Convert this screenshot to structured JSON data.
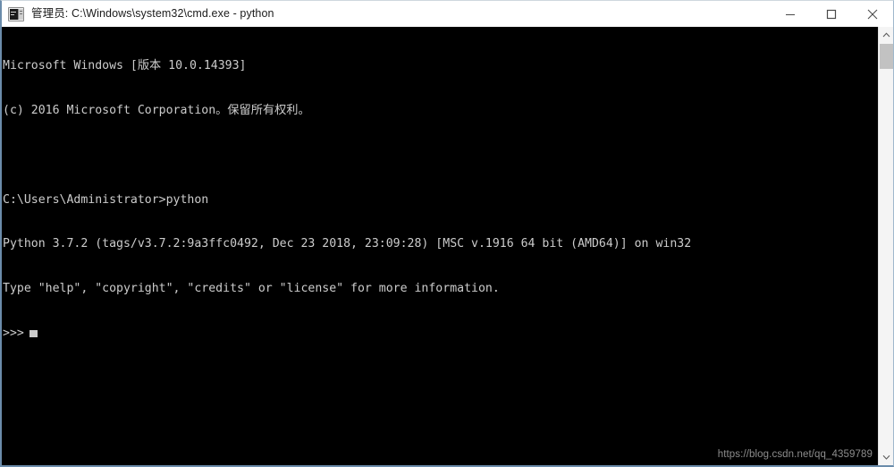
{
  "window": {
    "title": "管理员: C:\\Windows\\system32\\cmd.exe - python",
    "icon": "cmd-console-icon",
    "controls": {
      "minimize": "minimize-button",
      "maximize": "maximize-button",
      "close": "close-button"
    }
  },
  "console": {
    "background_color": "#000000",
    "text_color": "#cccccc",
    "lines": [
      "Microsoft Windows [版本 10.0.14393]",
      "(c) 2016 Microsoft Corporation。保留所有权利。",
      "",
      "C:\\Users\\Administrator>python",
      "Python 3.7.2 (tags/v3.7.2:9a3ffc0492, Dec 23 2018, 23:09:28) [MSC v.1916 64 bit (AMD64)] on win32",
      "Type \"help\", \"copyright\", \"credits\" or \"license\" for more information."
    ],
    "prompt": ">>>",
    "cursor": "block-cursor"
  },
  "watermark": {
    "text": "https://blog.csdn.net/qq_4359789"
  },
  "scrollbar": {
    "up_arrow": "chevron-up-icon",
    "down_arrow": "chevron-down-icon",
    "thumb": "scrollbar-thumb"
  }
}
